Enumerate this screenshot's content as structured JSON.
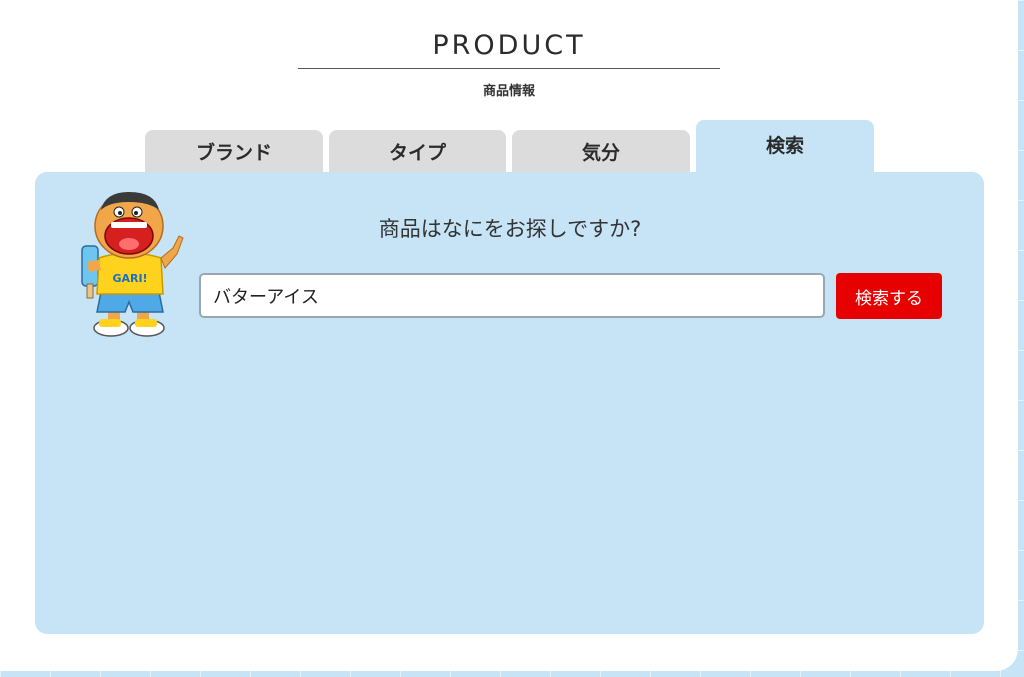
{
  "header": {
    "title": "PRODUCT",
    "subtitle": "商品情報"
  },
  "tabs": [
    {
      "label": "ブランド",
      "active": false
    },
    {
      "label": "タイプ",
      "active": false
    },
    {
      "label": "気分",
      "active": false
    },
    {
      "label": "検索",
      "active": true
    }
  ],
  "search": {
    "question": "商品はなにをお探しですか?",
    "value": "バターアイス",
    "button_label": "検索する"
  },
  "mascot": {
    "shirt_text": "GARI!"
  },
  "colors": {
    "panel_bg": "#c6e4f5",
    "tab_bg": "#dcdcdc",
    "accent_red": "#e60000"
  }
}
